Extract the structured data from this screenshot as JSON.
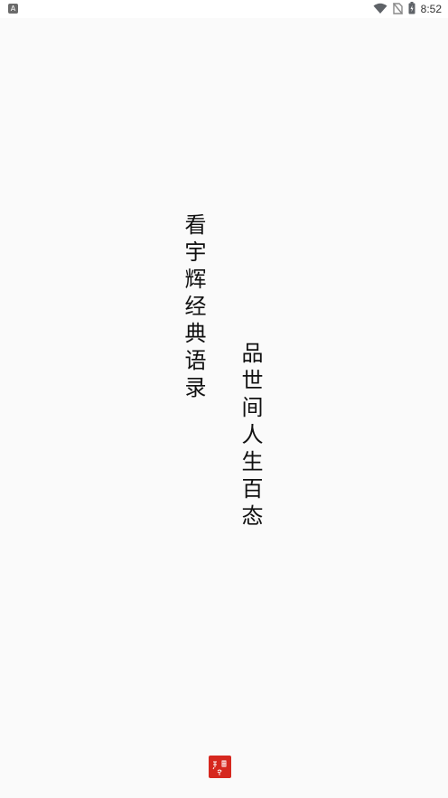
{
  "status_bar": {
    "time": "8:52",
    "left_icon": "keyboard-indicator-icon",
    "icons": [
      "wifi-icon",
      "no-sim-icon",
      "battery-charging-icon"
    ]
  },
  "splash": {
    "line_1": "看宇辉经典语录",
    "line_2": "品世间人生百态",
    "logo": "red-seal-logo"
  }
}
